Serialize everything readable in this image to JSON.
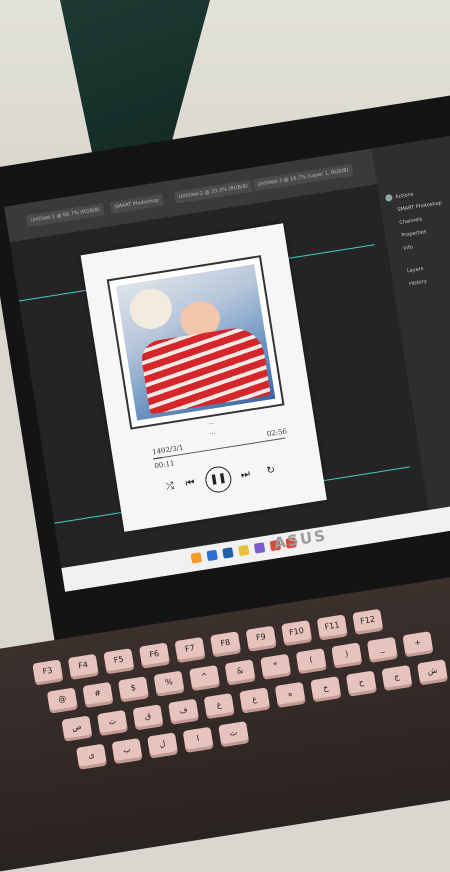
{
  "photoshop": {
    "tabs": [
      "Untitled-1 @ 66.7% (RGB/8)",
      "SMART Photoshop",
      "Untitled-2 @ 33.3% (RGB/8)",
      "Untitled-3 @ 16.7% (Layer 1, RGB/8)"
    ],
    "panel_items": [
      "Actions",
      "SMART Photoshop",
      "Channels",
      "Properties",
      "Info",
      "Layers",
      "History"
    ]
  },
  "player_card": {
    "caption_line1": "...",
    "caption_line2": "...",
    "time_left": "00:11",
    "time_right": "02:56",
    "date_label": "1402/3/1",
    "progress": 0.07,
    "controls": [
      "shuffle",
      "previous",
      "pause",
      "next",
      "repeat"
    ]
  },
  "laptop": {
    "brand": "ASUS"
  },
  "keyboard": {
    "keys": [
      "F3",
      "F4",
      "F5",
      "F6",
      "F7",
      "F8",
      "F9",
      "F10",
      "F11",
      "F12",
      "@",
      "#",
      "$",
      "%",
      "^",
      "&",
      "*",
      "(",
      ")",
      "_",
      "+",
      "ص",
      "ث",
      "ق",
      "ف",
      "غ",
      "ع",
      "ه",
      "خ",
      "ح",
      "ج",
      "ش",
      "س",
      "ی",
      "ب",
      "ل",
      "ا",
      "ت"
    ]
  },
  "colors": {
    "accent": "#3fd0c3",
    "shirt_red": "#d4262b"
  }
}
